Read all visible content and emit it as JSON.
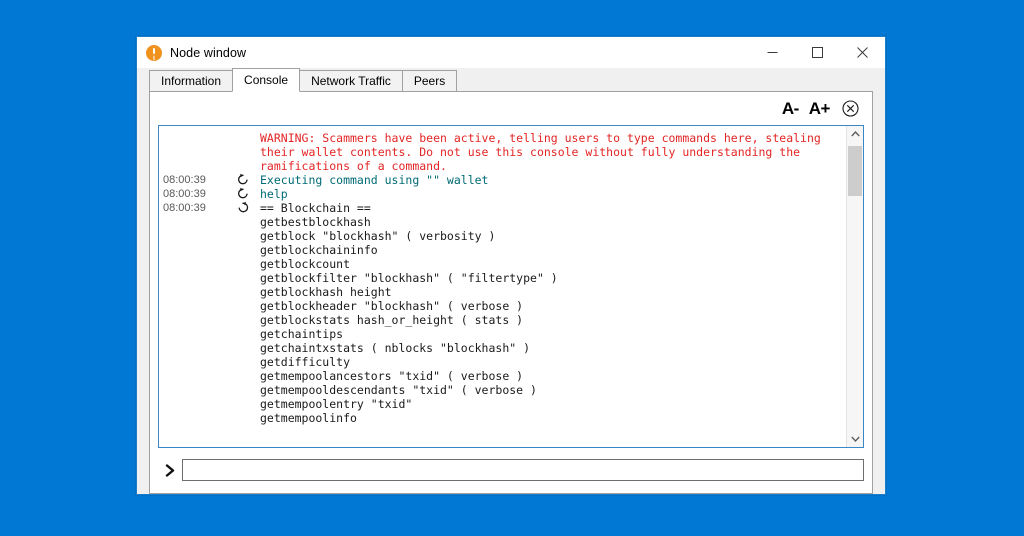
{
  "window": {
    "title": "Node window",
    "app_icon": "bitcoin-icon",
    "minimize_label": "Minimize",
    "maximize_label": "Maximize",
    "close_label": "Close"
  },
  "tabs": [
    {
      "label": "Information",
      "active": false
    },
    {
      "label": "Console",
      "active": true
    },
    {
      "label": "Network Traffic",
      "active": false
    },
    {
      "label": "Peers",
      "active": false
    }
  ],
  "toolbar": {
    "font_decrease_label": "A-",
    "font_increase_label": "A+",
    "clear_label": "clear-console-icon"
  },
  "console": {
    "lines": [
      {
        "timestamp": "",
        "icon": "",
        "type": "warning",
        "text": "WARNING: Scammers have been active, telling users to type commands here, stealing\ntheir wallet contents. Do not use this console without fully understanding the\nramifications of a command."
      },
      {
        "timestamp": "08:00:39",
        "icon": "outgoing-arrow-icon",
        "type": "command",
        "text": "Executing command using \"\" wallet"
      },
      {
        "timestamp": "08:00:39",
        "icon": "outgoing-arrow-icon",
        "type": "command",
        "text": "help"
      },
      {
        "timestamp": "08:00:39",
        "icon": "incoming-arrow-icon",
        "type": "output",
        "text": "== Blockchain ==\ngetbestblockhash\ngetblock \"blockhash\" ( verbosity )\ngetblockchaininfo\ngetblockcount\ngetblockfilter \"blockhash\" ( \"filtertype\" )\ngetblockhash height\ngetblockheader \"blockhash\" ( verbose )\ngetblockstats hash_or_height ( stats )\ngetchaintips\ngetchaintxstats ( nblocks \"blockhash\" )\ngetdifficulty\ngetmempoolancestors \"txid\" ( verbose )\ngetmempooldescendants \"txid\" ( verbose )\ngetmempoolentry \"txid\"\ngetmempoolinfo"
      }
    ]
  },
  "input": {
    "prompt_icon": "chevron-right-icon",
    "value": "",
    "placeholder": ""
  },
  "colors": {
    "desktop_background": "#0078d4",
    "warning_text": "#e42525",
    "command_text": "#006b75",
    "output_text": "#1a1a1a",
    "accent_border": "#3a87c8",
    "app_icon": "#f0921e"
  }
}
